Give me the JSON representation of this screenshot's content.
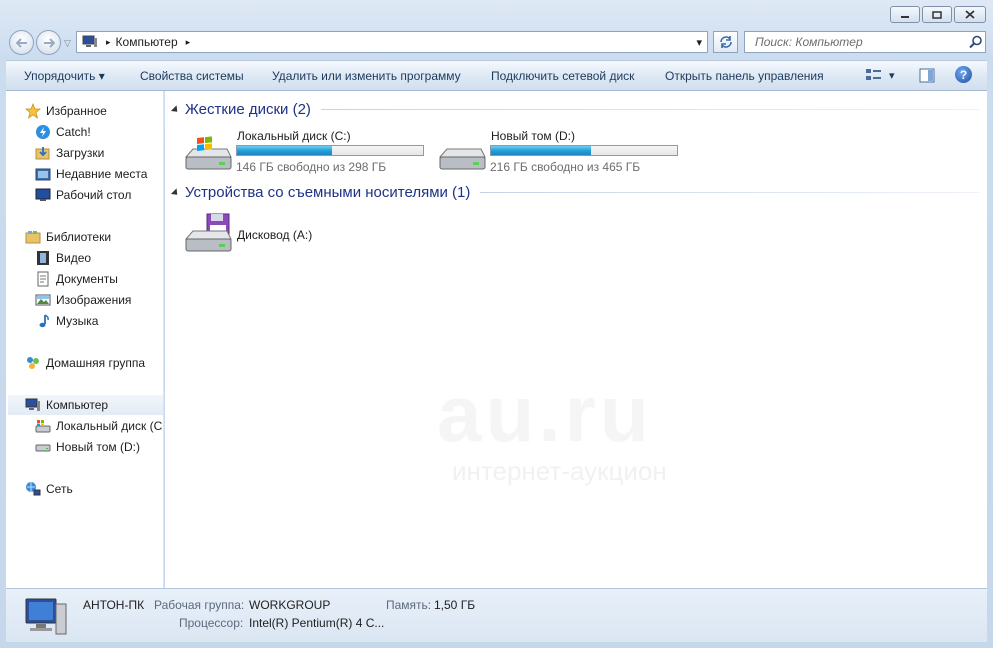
{
  "window": {
    "minimize_label": "–",
    "maximize_label": "□",
    "close_label": "✕"
  },
  "address": {
    "root_arrow": "▸",
    "path": "Компьютер",
    "path_arrow": "▸",
    "dropdown": "▾"
  },
  "search": {
    "placeholder": "Поиск: Компьютер"
  },
  "toolbar": {
    "organize": "Упорядочить ▾",
    "system_properties": "Свойства системы",
    "uninstall": "Удалить или изменить программу",
    "map_drive": "Подключить сетевой диск",
    "control_panel": "Открыть панель управления",
    "views_arrow": "▾",
    "help": "?"
  },
  "nav": {
    "favorites": "Избранное",
    "catch": "Catch!",
    "downloads": "Загрузки",
    "recent": "Недавние места",
    "desktop": "Рабочий стол",
    "libraries": "Библиотеки",
    "video": "Видео",
    "documents": "Документы",
    "images": "Изображения",
    "music": "Музыка",
    "homegroup": "Домашняя группа",
    "computer": "Компьютер",
    "local_c": "Локальный диск (C",
    "new_d": "Новый том (D:)",
    "network": "Сеть"
  },
  "content": {
    "hdd_group": "Жесткие диски (2)",
    "removable_group": "Устройства со съемными носителями (1)",
    "drives": [
      {
        "name": "Локальный диск (C:)",
        "free": "146 ГБ свободно из 298 ГБ",
        "used_fraction": 0.51
      },
      {
        "name": "Новый том (D:)",
        "free": "216 ГБ свободно из 465 ГБ",
        "used_fraction": 0.54
      }
    ],
    "floppy": "Дисковод (A:)"
  },
  "watermark": {
    "line1": "au.ru",
    "line2": "интернет-аукцион"
  },
  "details": {
    "pc_name": "АНТОН-ПК",
    "workgroup_label": "Рабочая группа:",
    "workgroup_value": "WORKGROUP",
    "memory_label": "Память:",
    "memory_value": "1,50 ГБ",
    "cpu_label": "Процессор:",
    "cpu_value": "Intel(R) Pentium(R) 4 C..."
  },
  "colors": {
    "accent": "#1e3287",
    "bar_fill": "#26a0da"
  }
}
